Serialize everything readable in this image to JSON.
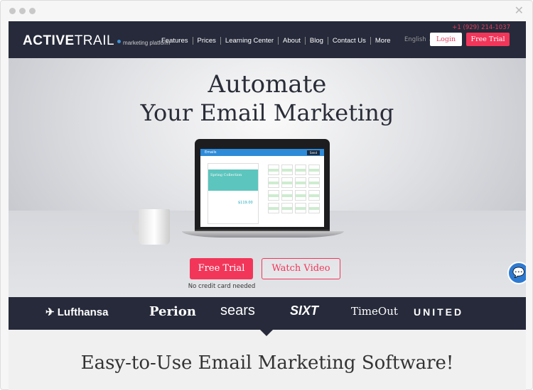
{
  "window": {
    "close_icon": "close-icon"
  },
  "nav": {
    "logo_bold": "ACTIVE",
    "logo_light": "TRAIL",
    "logo_tagline": "marketing platform",
    "items": [
      "Features",
      "Prices",
      "Learning Center",
      "About",
      "Blog",
      "Contact Us",
      "More"
    ],
    "phone": "+1 (929) 214-1037",
    "language": "English",
    "login": "Login",
    "free_trial": "Free Trial"
  },
  "hero": {
    "title": "Automate",
    "subtitle": "Your Email Marketing",
    "cta_primary": "Free Trial",
    "cta_secondary": "Watch Video",
    "note": "No credit card needed",
    "screen": {
      "title": "Emails",
      "send": "Send",
      "promo": "Spring Collection",
      "price": "$119.00"
    }
  },
  "clients": [
    "Lufthansa",
    "Perion",
    "sears",
    "SIXT",
    "TimeOut",
    "UNITED"
  ],
  "section": {
    "title": "Easy-to-Use Email Marketing Software!"
  },
  "colors": {
    "accent": "#f2365a",
    "nav": "#262a3a",
    "chat": "#2e7ad1"
  }
}
